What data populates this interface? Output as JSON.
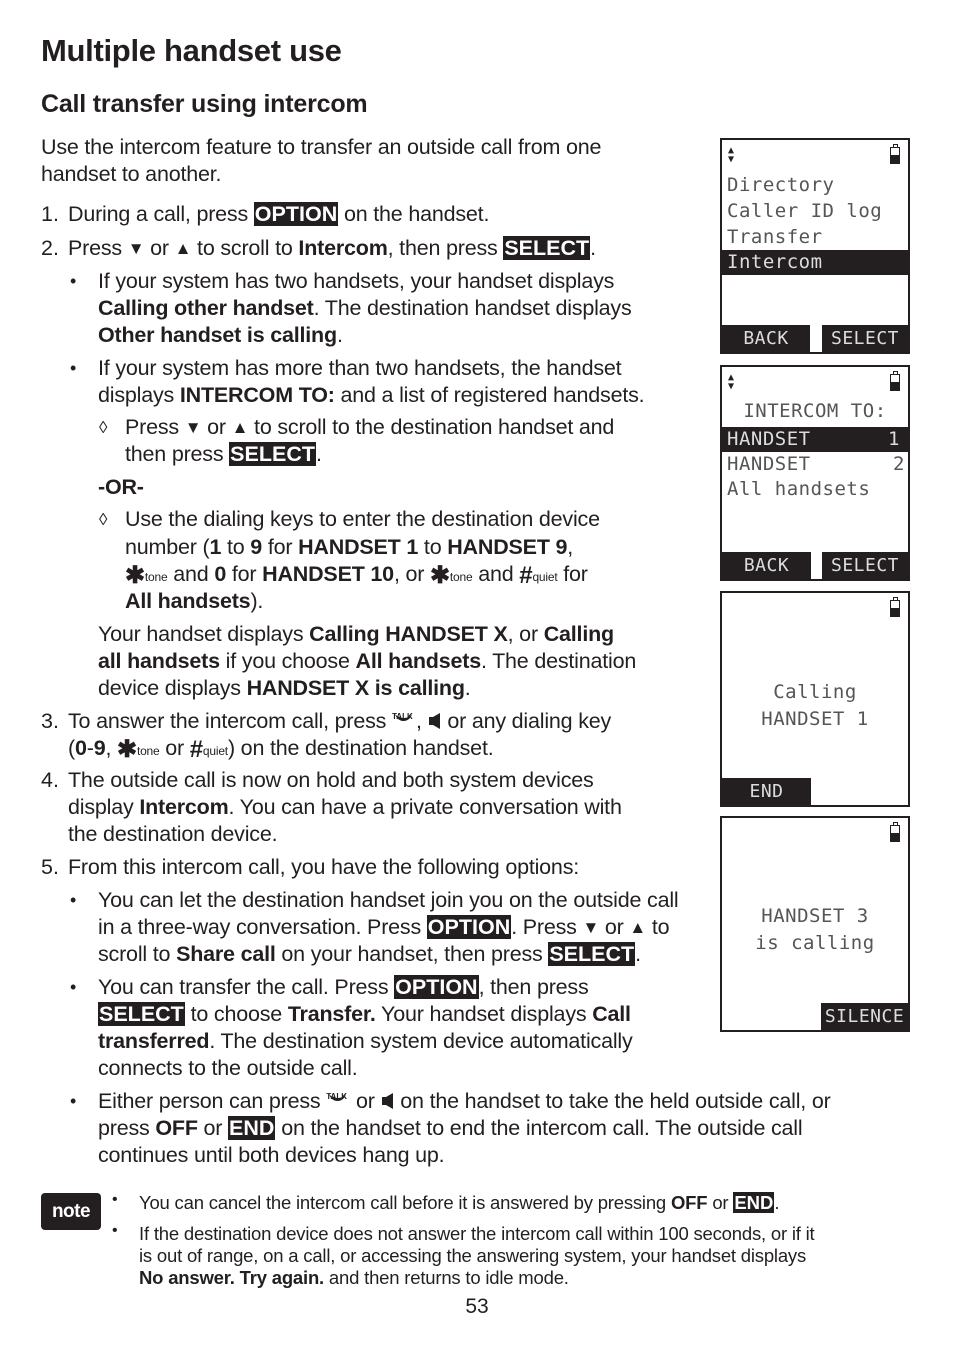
{
  "header": {
    "title": "Multiple handset use",
    "subtitle": "Call transfer using intercom"
  },
  "intro": [
    "Use the intercom feature to transfer an outside call from one",
    "handset to another."
  ],
  "keys": {
    "option": "OPTION",
    "select": "SELECT",
    "end": "END",
    "down": "▼",
    "up": "▲",
    "star": "✱",
    "star_sub": "tone",
    "hash": "#",
    "hash_sub": "quiet",
    "talk_sub": "TALK"
  },
  "steps": {
    "s1": {
      "num": "1.",
      "a": "During a call, press ",
      "b": " on the handset."
    },
    "s2": {
      "num": "2.",
      "a": "Press ",
      "b": " or ",
      "c": " to scroll to ",
      "bold": "Intercom",
      "d": ", then press ",
      "e": "."
    },
    "b1": {
      "l1": "If your system has two handsets, your handset displays",
      "l2_bold": "Calling other handset",
      "l2": ". The destination handset displays",
      "l3_bold": "Other handset is calling",
      "l3": "."
    },
    "b2": {
      "l1": "If your system has more than two handsets, the handset",
      "l2a": "displays ",
      "l2_bold": "INTERCOM TO:",
      "l2b": " and a list of registered handsets."
    },
    "d1": {
      "a": "Press ",
      "b": " or ",
      "c": " to scroll to the destination handset and",
      "l2a": "then press ",
      "l2b": "."
    },
    "or": "-OR-",
    "d2": {
      "l1": "Use the dialing keys to enter the destination device",
      "l2a": "number (",
      "l2b": "1",
      "l2c": " to ",
      "l2d": "9",
      "l2e": " for ",
      "l2f": "HANDSET 1",
      "l2g": " to ",
      "l2h": "HANDSET 9",
      "l2i": ",",
      "l3a": " and ",
      "l3b": "0",
      "l3c": " for ",
      "l3d": "HANDSET 10",
      "l3e": ", or ",
      "l3f": " and ",
      "l3g": " for",
      "l4a": "All handsets",
      "l4b": ")."
    },
    "your": {
      "l1a": "Your handset displays ",
      "l1b": "Calling HANDSET X",
      "l1c": ", or ",
      "l1d": "Calling",
      "l2a": "all handsets",
      "l2b": " if you choose ",
      "l2c": "All handsets",
      "l2d": ". The destination",
      "l3a": "device displays ",
      "l3b": "HANDSET X is calling",
      "l3c": "."
    },
    "s3": {
      "num": "3.",
      "a": "To answer the intercom call, press ",
      "b": ",",
      "c": " or any dialing key",
      "l2a": "(",
      "l2b": "0",
      "l2c": "-",
      "l2d": "9",
      "l2e": ", ",
      "l2f": " or ",
      "l2g": ") on the destination handset."
    },
    "s4": {
      "num": "4.",
      "l1": "The outside call is now on hold and both system devices",
      "l2a": "display ",
      "l2b": "Intercom",
      "l2c": ". You can have a private conversation with",
      "l3": "the destination device."
    },
    "s5": {
      "num": "5.",
      "l1": "From this intercom call, you have the following options:"
    },
    "o1": {
      "l1": "You can let the destination handset join you on the outside call",
      "l2a": "in a three-way conversation. Press ",
      "l2b": ". Press ",
      "l2c": " or ",
      "l2d": " to",
      "l3a": "scroll to ",
      "l3b": "Share call",
      "l3c": " on your handset, then press ",
      "l3d": "."
    },
    "o2": {
      "l1a": "You can transfer the call. Press ",
      "l1b": ", then press",
      "l2a": " to choose ",
      "l2b": "Transfer.",
      "l2c": " Your handset displays ",
      "l2d": "Call",
      "l3a": "transferred",
      "l3b": ". The destination system device automatically",
      "l4": "connects to the outside call."
    },
    "o3": {
      "l1a": "Either person can press ",
      "l1b": " or ",
      "l1c": " on the handset to take the held outside call, or",
      "l2a": "press ",
      "l2b": "OFF",
      "l2c": " or ",
      "l2d": " on the handset to end the intercom call. The outside call",
      "l3": "continues until both devices hang up."
    }
  },
  "note": {
    "badge": "note",
    "n1a": "You can cancel the intercom call before it is answered by pressing ",
    "n1b": "OFF",
    "n1c": " or ",
    "n1d": ".",
    "n2l1": "If the destination device does not answer the intercom call within 100 seconds, or if it",
    "n2l2": "is out of range, on a call, or accessing the answering system, your handset displays",
    "n2l3a": "No answer. Try again.",
    "n2l3b": " and then returns to idle mode."
  },
  "screens": [
    {
      "rows": [
        "Directory",
        "Caller ID log",
        "Transfer",
        "Intercom"
      ],
      "selected": "Intercom",
      "soft_left": "BACK",
      "soft_right": "SELECT"
    },
    {
      "title": "INTERCOM TO:",
      "rows": [
        {
          "label": "HANDSET",
          "num": "1"
        },
        {
          "label": "HANDSET",
          "num": "2"
        },
        {
          "label": "All handsets",
          "num": ""
        }
      ],
      "soft_left": "BACK",
      "soft_right": "SELECT"
    },
    {
      "l1": "Calling",
      "l2": "HANDSET 1",
      "soft_left": "END"
    },
    {
      "l1": "HANDSET 3",
      "l2": "is calling",
      "soft_right": "SILENCE"
    }
  ],
  "page_number": "53"
}
